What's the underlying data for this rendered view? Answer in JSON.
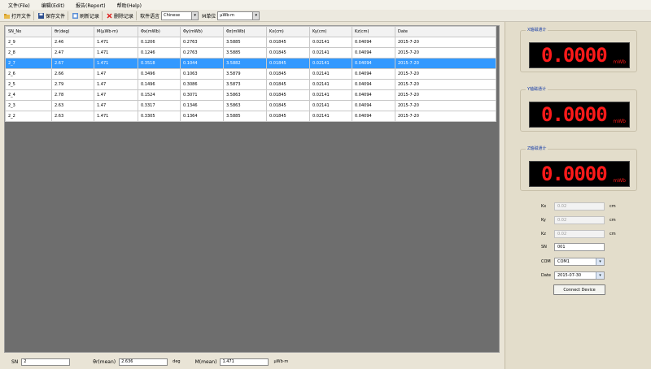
{
  "menu": [
    "文件(File)",
    "编辑(Edit)",
    "报告(Report)",
    "帮助(Help)"
  ],
  "toolbar": {
    "open": "打开文件",
    "save": "保存文件",
    "refresh": "刷新记录",
    "delete": "删除记录",
    "lang_label": "软件语言",
    "lang_value": "Chinese",
    "unit_label": "M单位",
    "unit_value": "μWb·m"
  },
  "table": {
    "headers": [
      "SN_No",
      "θr(deg)",
      "M(μWb·m)",
      "Φx(mWb)",
      "Φy(mWb)",
      "Φz(mWb)",
      "Kx(cm)",
      "Ky(cm)",
      "Kz(cm)",
      "Date"
    ],
    "rows": [
      [
        "2_9",
        "2.46",
        "1.471",
        "0.1206",
        "0.2763",
        "3.5885",
        "0.01845",
        "0.02141",
        "0.04094",
        "2015-7-20"
      ],
      [
        "2_8",
        "2.47",
        "1.471",
        "0.1246",
        "0.2763",
        "3.5885",
        "0.01845",
        "0.02141",
        "0.04094",
        "2015-7-20"
      ],
      [
        "2_7",
        "2.67",
        "1.471",
        "0.3518",
        "0.1044",
        "3.5882",
        "0.01845",
        "0.02141",
        "0.04094",
        "2015-7-20"
      ],
      [
        "2_6",
        "2.66",
        "1.47",
        "0.3496",
        "0.1063",
        "3.5879",
        "0.01845",
        "0.02141",
        "0.04094",
        "2015-7-20"
      ],
      [
        "2_5",
        "2.79",
        "1.47",
        "0.1496",
        "0.3086",
        "3.5873",
        "0.01845",
        "0.02141",
        "0.04094",
        "2015-7-20"
      ],
      [
        "2_4",
        "2.78",
        "1.47",
        "0.1524",
        "0.3071",
        "3.5863",
        "0.01845",
        "0.02141",
        "0.04094",
        "2015-7-20"
      ],
      [
        "2_3",
        "2.63",
        "1.47",
        "0.3317",
        "0.1346",
        "3.5863",
        "0.01845",
        "0.02141",
        "0.04094",
        "2015-7-20"
      ],
      [
        "2_2",
        "2.63",
        "1.471",
        "0.3305",
        "0.1364",
        "3.5885",
        "0.01845",
        "0.02141",
        "0.04094",
        "2015-7-20"
      ]
    ],
    "selected_index": 2
  },
  "footer": {
    "sn_label": "SN",
    "sn_value": "2",
    "theta_label": "θr(mean)",
    "theta_value": "2.636",
    "theta_unit": "deg",
    "m_label": "M(mean)",
    "m_value": "1.471",
    "m_unit": "μWb·m"
  },
  "meters": [
    {
      "title": "X轴磁通计",
      "value": "0.0000",
      "unit": "mWb"
    },
    {
      "title": "Y轴磁通计",
      "value": "0.0000",
      "unit": "mWb"
    },
    {
      "title": "Z轴磁通计",
      "value": "0.0000",
      "unit": "mWb"
    }
  ],
  "form": {
    "kx_label": "Kx",
    "kx_value": "0.02",
    "kx_unit": "cm",
    "ky_label": "Ky",
    "ky_value": "0.02",
    "ky_unit": "cm",
    "kz_label": "Kz",
    "kz_value": "0.02",
    "kz_unit": "cm",
    "sn_label": "SN",
    "sn_value": "001",
    "com_label": "COM",
    "com_value": "COM1",
    "date_label": "Date",
    "date_value": "2015-07-30",
    "connect_label": "Connect Device"
  },
  "colors": {
    "selection": "#3399ff",
    "led": "#ff1a1a",
    "panel": "#e3ddcb"
  }
}
